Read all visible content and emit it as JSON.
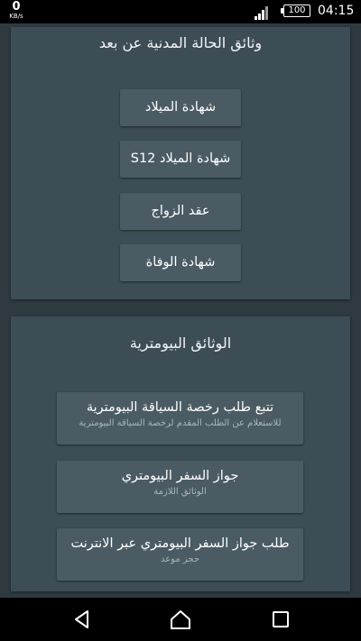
{
  "status_bar": {
    "net_speed": "0",
    "net_unit": "KB/s",
    "battery": "100",
    "time": "04:15"
  },
  "civil_docs": {
    "title": "وثائق الحالة المدنية عن بعد",
    "buttons": [
      {
        "label": "شهادة الميلاد"
      },
      {
        "label": "شهادة الميلاد S12"
      },
      {
        "label": "عقد الزواج"
      },
      {
        "label": "شهادة الوفاة"
      }
    ]
  },
  "biometric_docs": {
    "title": "الوثائق البيومترية",
    "buttons": [
      {
        "label": "تتبع طلب رخصة السياقة البيومترية",
        "sub": "للاستعلام عن الطلب المقدم لرخصة السياقة البيومترية"
      },
      {
        "label": "جواز السفر البيومتري",
        "sub": "الوثائق اللازمة"
      },
      {
        "label": "طلب جواز السفر البيومتري عبر الانترنت",
        "sub": "حجز موعد"
      }
    ]
  },
  "nav_bar": {
    "back_icon": "triangle-back",
    "home_icon": "circle-home",
    "recents_icon": "square-recents"
  },
  "colors": {
    "background": "#2e3a40",
    "card": "#3d4d55",
    "button": "#4a5b63",
    "subtitle": "#aab6bb"
  }
}
